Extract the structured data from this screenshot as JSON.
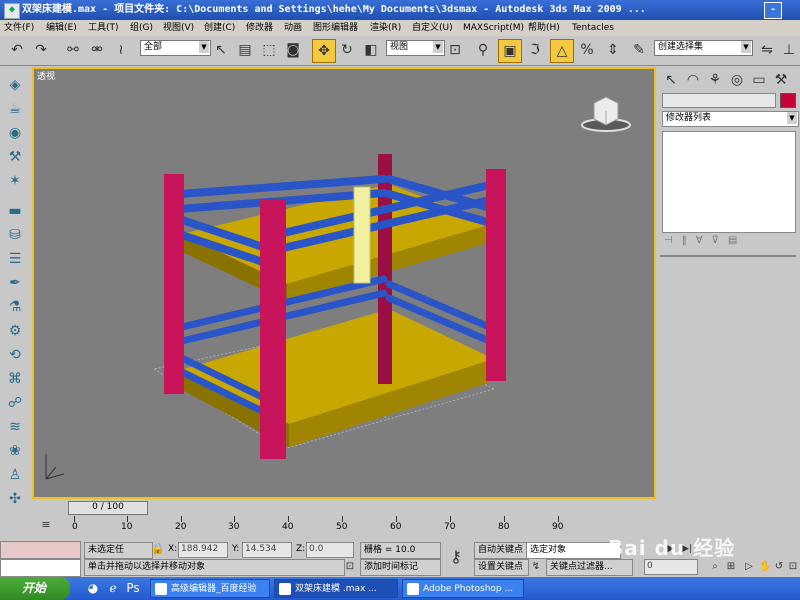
{
  "window": {
    "title": "双架床建模.max  - 项目文件夹: C:\\Documents and Settings\\hehe\\My Documents\\3dsmax  - Autodesk 3ds Max  2009  ...",
    "minimize_label": "-"
  },
  "menu": [
    "文件(F)",
    "编辑(E)",
    "工具(T)",
    "组(G)",
    "视图(V)",
    "创建(C)",
    "修改器",
    "动画",
    "图形编辑器",
    "渲染(R)",
    "自定义(U)",
    "MAXScript(M)",
    "帮助(H)",
    "Tentacles"
  ],
  "toolbar": {
    "selection_filter": "全部",
    "reference_coord": "视图",
    "named_selection": "创建选择集"
  },
  "viewport": {
    "label": "透视",
    "highlight_color": "#f0c020",
    "background_color": "#7e7e7e"
  },
  "command_panel": {
    "modifier_list": "修改器列表",
    "object_color": "#c8003a"
  },
  "time_slider": {
    "frame": "0 / 100"
  },
  "ruler": {
    "labels": [
      "0",
      "10",
      "20",
      "30",
      "40",
      "50",
      "60",
      "70",
      "80",
      "90"
    ]
  },
  "status": {
    "selection": "未选定任",
    "x_label": "X:",
    "x_value": "188.942",
    "y_label": "Y:",
    "y_value": "14.534",
    "z_label": "Z:",
    "z_value": "0.0",
    "grid": "栅格 = 10.0",
    "prompt": "单击并拖动以选择并移动对象",
    "add_time_tag": "添加时间标记",
    "auto_key": "自动关键点",
    "set_key": "设置关键点",
    "key_filter_select": "选定对象",
    "key_filters": "关键点过滤器...",
    "frame_field": "0"
  },
  "taskbar": {
    "start": "开始",
    "tasks": [
      "高级编辑器_百度经验",
      "双架床建模 .max ...",
      "Adobe Photoshop ..."
    ]
  },
  "watermark": "Bai du 经验",
  "colors": {
    "post": "#c8145a",
    "rail": "#2a55c8",
    "mattress": "#b89a00",
    "ladder": "#f0f0a0"
  }
}
